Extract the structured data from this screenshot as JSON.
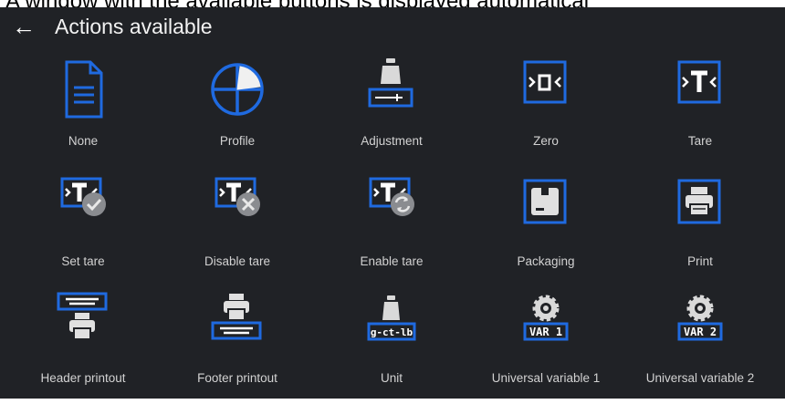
{
  "caption": "A window with the available buttons is displayed automatical",
  "header": {
    "back_icon": "arrow-left-icon",
    "title": "Actions available"
  },
  "colors": {
    "background": "#202226",
    "accent": "#1f6ae0",
    "icon_fill": "#ececec",
    "overlay_badge": "#8a8c90"
  },
  "actions": [
    {
      "label": "None",
      "icon": "document-icon"
    },
    {
      "label": "Profile",
      "icon": "profile-icon"
    },
    {
      "label": "Adjustment",
      "icon": "adjustment-icon"
    },
    {
      "label": "Zero",
      "icon": "zero-icon",
      "glyph": ">0<"
    },
    {
      "label": "Tare",
      "icon": "tare-icon",
      "glyph": ">T<"
    },
    {
      "label": "Set tare",
      "icon": "set-tare-icon",
      "glyph": ">T<"
    },
    {
      "label": "Disable tare",
      "icon": "disable-tare-icon",
      "glyph": ">T<"
    },
    {
      "label": "Enable tare",
      "icon": "enable-tare-icon",
      "glyph": ">T<"
    },
    {
      "label": "Packaging",
      "icon": "packaging-icon"
    },
    {
      "label": "Print",
      "icon": "printer-icon"
    },
    {
      "label": "Header printout",
      "icon": "header-printout-icon"
    },
    {
      "label": "Footer printout",
      "icon": "footer-printout-icon"
    },
    {
      "label": "Unit",
      "icon": "unit-icon",
      "badge": "g-ct-lb"
    },
    {
      "label": "Universal variable 1",
      "icon": "universal-variable-1-icon",
      "badge": "VAR 1"
    },
    {
      "label": "Universal variable 2",
      "icon": "universal-variable-2-icon",
      "badge": "VAR 2"
    }
  ]
}
